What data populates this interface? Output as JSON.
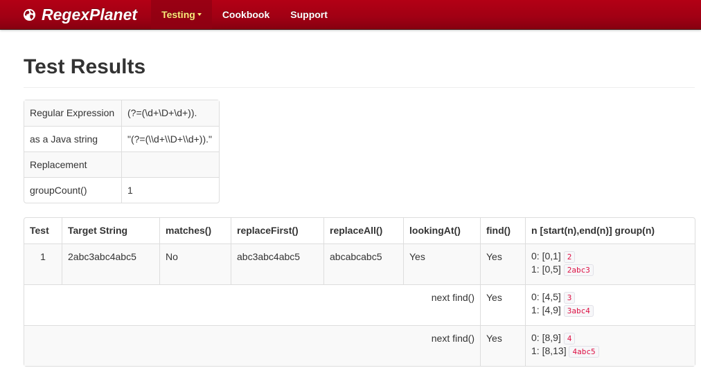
{
  "navbar": {
    "brand": "RegexPlanet",
    "brand_icon": "globe-icon",
    "items": [
      {
        "label": "Testing",
        "active": true,
        "dropdown": true
      },
      {
        "label": "Cookbook",
        "active": false
      },
      {
        "label": "Support",
        "active": false
      }
    ],
    "colors": {
      "background": "#a80014",
      "active_text": "#ffeb7a"
    }
  },
  "page_title": "Test Results",
  "info_table": [
    {
      "key": "Regular Expression",
      "value": "(?=(\\d+\\D+\\d+))."
    },
    {
      "key": "as a Java string",
      "value": "\"(?=(\\\\d+\\\\D+\\\\d+)).\""
    },
    {
      "key": "Replacement",
      "value": ""
    },
    {
      "key": "groupCount()",
      "value": "1"
    }
  ],
  "results_table": {
    "headers": [
      "Test",
      "Target String",
      "matches()",
      "replaceFirst()",
      "replaceAll()",
      "lookingAt()",
      "find()",
      "n [start(n),end(n)] group(n)"
    ],
    "first_row": {
      "test": "1",
      "target": "2abc3abc4abc5",
      "matches": "No",
      "replaceFirst": "abc3abc4abc5",
      "replaceAll": "abcabcabc5",
      "lookingAt": "Yes",
      "find": "Yes",
      "groups": [
        {
          "label": "0: [0,1]",
          "value": "2"
        },
        {
          "label": "1: [0,5]",
          "value": "2abc3"
        }
      ]
    },
    "next_rows": [
      {
        "label": "next find()",
        "find": "Yes",
        "groups": [
          {
            "label": "0: [4,5]",
            "value": "3"
          },
          {
            "label": "1: [4,9]",
            "value": "3abc4"
          }
        ]
      },
      {
        "label": "next find()",
        "find": "Yes",
        "groups": [
          {
            "label": "0: [8,9]",
            "value": "4"
          },
          {
            "label": "1: [8,13]",
            "value": "4abc5"
          }
        ]
      }
    ]
  }
}
